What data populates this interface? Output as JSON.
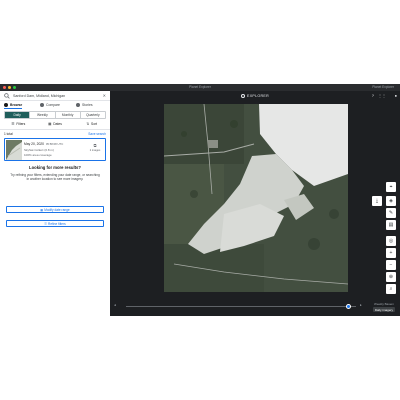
{
  "window": {
    "title": "Planet Explorer",
    "right_text": "Planet Explorer"
  },
  "search": {
    "value": "Sanford Dam, Midland, Michigan",
    "clear_icon": "close-icon"
  },
  "tabs": [
    {
      "label": "Browse",
      "icon": "compass-icon"
    },
    {
      "label": "Compare",
      "icon": "compare-icon"
    },
    {
      "label": "Stories",
      "icon": "stories-icon"
    }
  ],
  "periods": [
    "Daily",
    "Weekly",
    "Monthly",
    "Quarterly"
  ],
  "actions": {
    "filters": "Filters",
    "dates": "Dates",
    "sort": "Sort"
  },
  "results": {
    "total": "1 total",
    "save": "Save search"
  },
  "card": {
    "date": "May 20, 2020",
    "time": "05:58:08 UTC",
    "source": "SkySat Collect (0.8 m)",
    "coverage": "100% area coverage",
    "images_label": "2 images"
  },
  "more": {
    "title": "Looking for more results?",
    "body": "Try refining your filters, extending your date range, or searching in another location to see more imagery.",
    "modify_dates": "Modify date range",
    "refine_filters": "Refine filters"
  },
  "topbar": {
    "brand": "EXPLORER"
  },
  "timeline": {
    "weekly": "Weekly Basem",
    "daily": "Daily imagery"
  },
  "colors": {
    "accent": "#1a73e8",
    "period_active": "#1f5e5b",
    "app_bg": "#1d1f22"
  }
}
